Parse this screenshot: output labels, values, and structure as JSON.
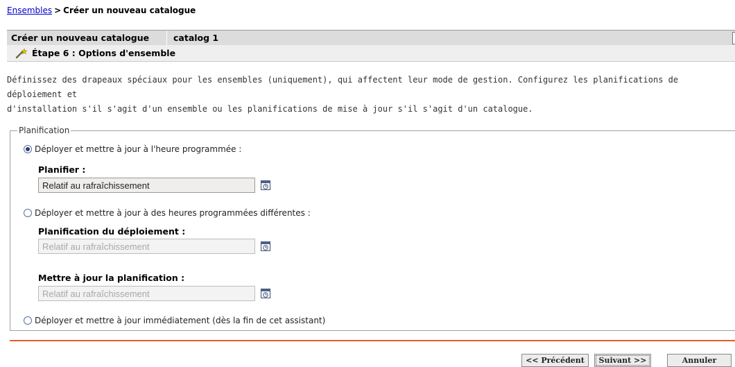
{
  "breadcrumb": {
    "link": "Ensembles",
    "separator": ">",
    "current": "Créer un nouveau catalogue"
  },
  "wizard": {
    "title": "Créer un nouveau catalogue",
    "name": "catalog 1",
    "help": "?"
  },
  "step": {
    "icon": "wand-icon",
    "title": "Étape 6 : Options d'ensemble"
  },
  "description": {
    "line1": "Définissez des drapeaux spéciaux pour les ensembles (uniquement), qui affectent leur mode de gestion. Configurez les planifications de déploiement et",
    "line2": "d'installation s'il s'agit d'un ensemble ou les planifications de mise à jour s'il s'agit d'un catalogue."
  },
  "planning": {
    "legend": "Planification",
    "option1": {
      "label": "Déployer et mettre à jour à l'heure programmée :",
      "selected": true
    },
    "schedule": {
      "label": "Planifier :",
      "value": "Relatif au rafraîchissement"
    },
    "option2": {
      "label": "Déployer et mettre à jour à des heures programmées différentes :",
      "selected": false
    },
    "deploy_schedule": {
      "label": "Planification du déploiement :",
      "value": "Relatif au rafraîchissement"
    },
    "update_schedule": {
      "label": "Mettre à jour la planification :",
      "value": "Relatif au rafraîchissement"
    },
    "option3": {
      "label": "Déployer et mettre à jour immédiatement (dès la fin de cet assistant)",
      "selected": false
    }
  },
  "buttons": {
    "previous": "<< Précédent",
    "next": "Suivant >>",
    "cancel": "Annuler"
  },
  "colors": {
    "accent_rule": "#ea5a22",
    "link": "#0000cc"
  }
}
